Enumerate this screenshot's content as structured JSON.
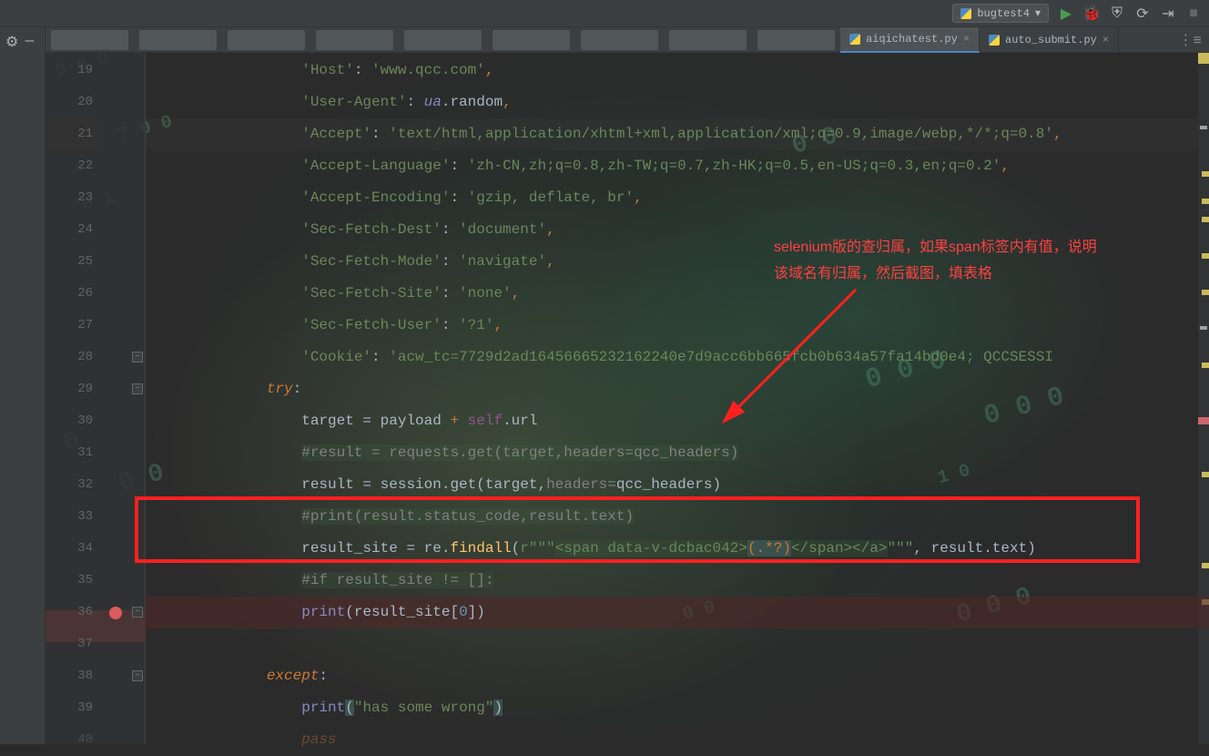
{
  "toolbar": {
    "run_config": "bugtest4"
  },
  "tabs": {
    "active": "aiqichatest.py",
    "other": "auto_submit.py"
  },
  "annotation": {
    "line1": "selenium版的查归属，如果span标签内有值，说明",
    "line2": "该域名有归属，然后截图，填表格"
  },
  "code": {
    "l19": {
      "indent": "            ",
      "k": "'Host'",
      "c": ": ",
      "v": "'www.qcc.com'",
      "e": ","
    },
    "l20": {
      "indent": "            ",
      "k": "'User-Agent'",
      "c": ": ",
      "obj": "ua",
      "m": ".random",
      "e": ","
    },
    "l21": {
      "indent": "            ",
      "k": "'Accept'",
      "c": ": ",
      "v": "'text/html,application/xhtml+xml,application/xml;q=0.9,image/webp,*/*;q=0.8'",
      "e": ","
    },
    "l22": {
      "indent": "            ",
      "k": "'Accept-Language'",
      "c": ": ",
      "v": "'zh-CN,zh;q=0.8,zh-TW;q=0.7,zh-HK;q=0.5,en-US;q=0.3,en;q=0.2'",
      "e": ","
    },
    "l23": {
      "indent": "            ",
      "k": "'Accept-Encoding'",
      "c": ": ",
      "v": "'gzip, deflate, br'",
      "e": ","
    },
    "l24": {
      "indent": "            ",
      "k": "'Sec-Fetch-Dest'",
      "c": ": ",
      "v": "'document'",
      "e": ","
    },
    "l25": {
      "indent": "            ",
      "k": "'Sec-Fetch-Mode'",
      "c": ": ",
      "v": "'navigate'",
      "e": ","
    },
    "l26": {
      "indent": "            ",
      "k": "'Sec-Fetch-Site'",
      "c": ": ",
      "v": "'none'",
      "e": ","
    },
    "l27": {
      "indent": "            ",
      "k": "'Sec-Fetch-User'",
      "c": ": ",
      "v": "'?1'",
      "e": ","
    },
    "l28": {
      "indent": "            ",
      "k": "'Cookie'",
      "c": ": ",
      "v": "'acw_tc=7729d2ad16456665232162240e7d9acc6bb665fcb0b634a57fa14bd0e4; QCCSESSI"
    },
    "l29": {
      "indent": "        ",
      "kw": "try",
      "e": ":"
    },
    "l30": {
      "indent": "            ",
      "var": "target = payload ",
      "op": "+",
      "sp": " ",
      "self": "self",
      "m": ".url"
    },
    "l31": {
      "indent": "            ",
      "cm": "#result = requests.get(target,headers=qcc_headers)"
    },
    "l32": {
      "indent": "            ",
      "txt1": "result = session.get(target,",
      "pn": "headers=",
      "txt2": "qcc_headers)"
    },
    "l33": {
      "indent": "            ",
      "cm": "#print(result.status_code,result.text)"
    },
    "l34": {
      "indent": "            ",
      "var": "result_site = re.",
      "fn": "findall",
      "p1": "(",
      "rpre": "r",
      "q1": "\"\"\"",
      "rx1": "<span data-v-dcbac042>",
      "grp": "(.*?)",
      "rx2": "</span></a>",
      "q2": "\"\"\"",
      "rest": ", result.text)"
    },
    "l35": {
      "indent": "            ",
      "cm": "#if result_site != []:"
    },
    "l36": {
      "indent": "            ",
      "fn": "print",
      "p1": "(result_site[",
      "n": "0",
      "p2": "])"
    },
    "l38": {
      "indent": "        ",
      "kw": "except",
      "e": ":"
    },
    "l39": {
      "indent": "            ",
      "fn": "print",
      "p1": "(",
      "s": "\"has some wrong\"",
      "p2": ")"
    },
    "l40": {
      "indent": "            ",
      "kw": "pass"
    }
  },
  "line_numbers": [
    "19",
    "20",
    "21",
    "22",
    "23",
    "24",
    "25",
    "26",
    "27",
    "28",
    "29",
    "30",
    "31",
    "32",
    "33",
    "34",
    "35",
    "36",
    "37",
    "38",
    "39",
    "40"
  ]
}
